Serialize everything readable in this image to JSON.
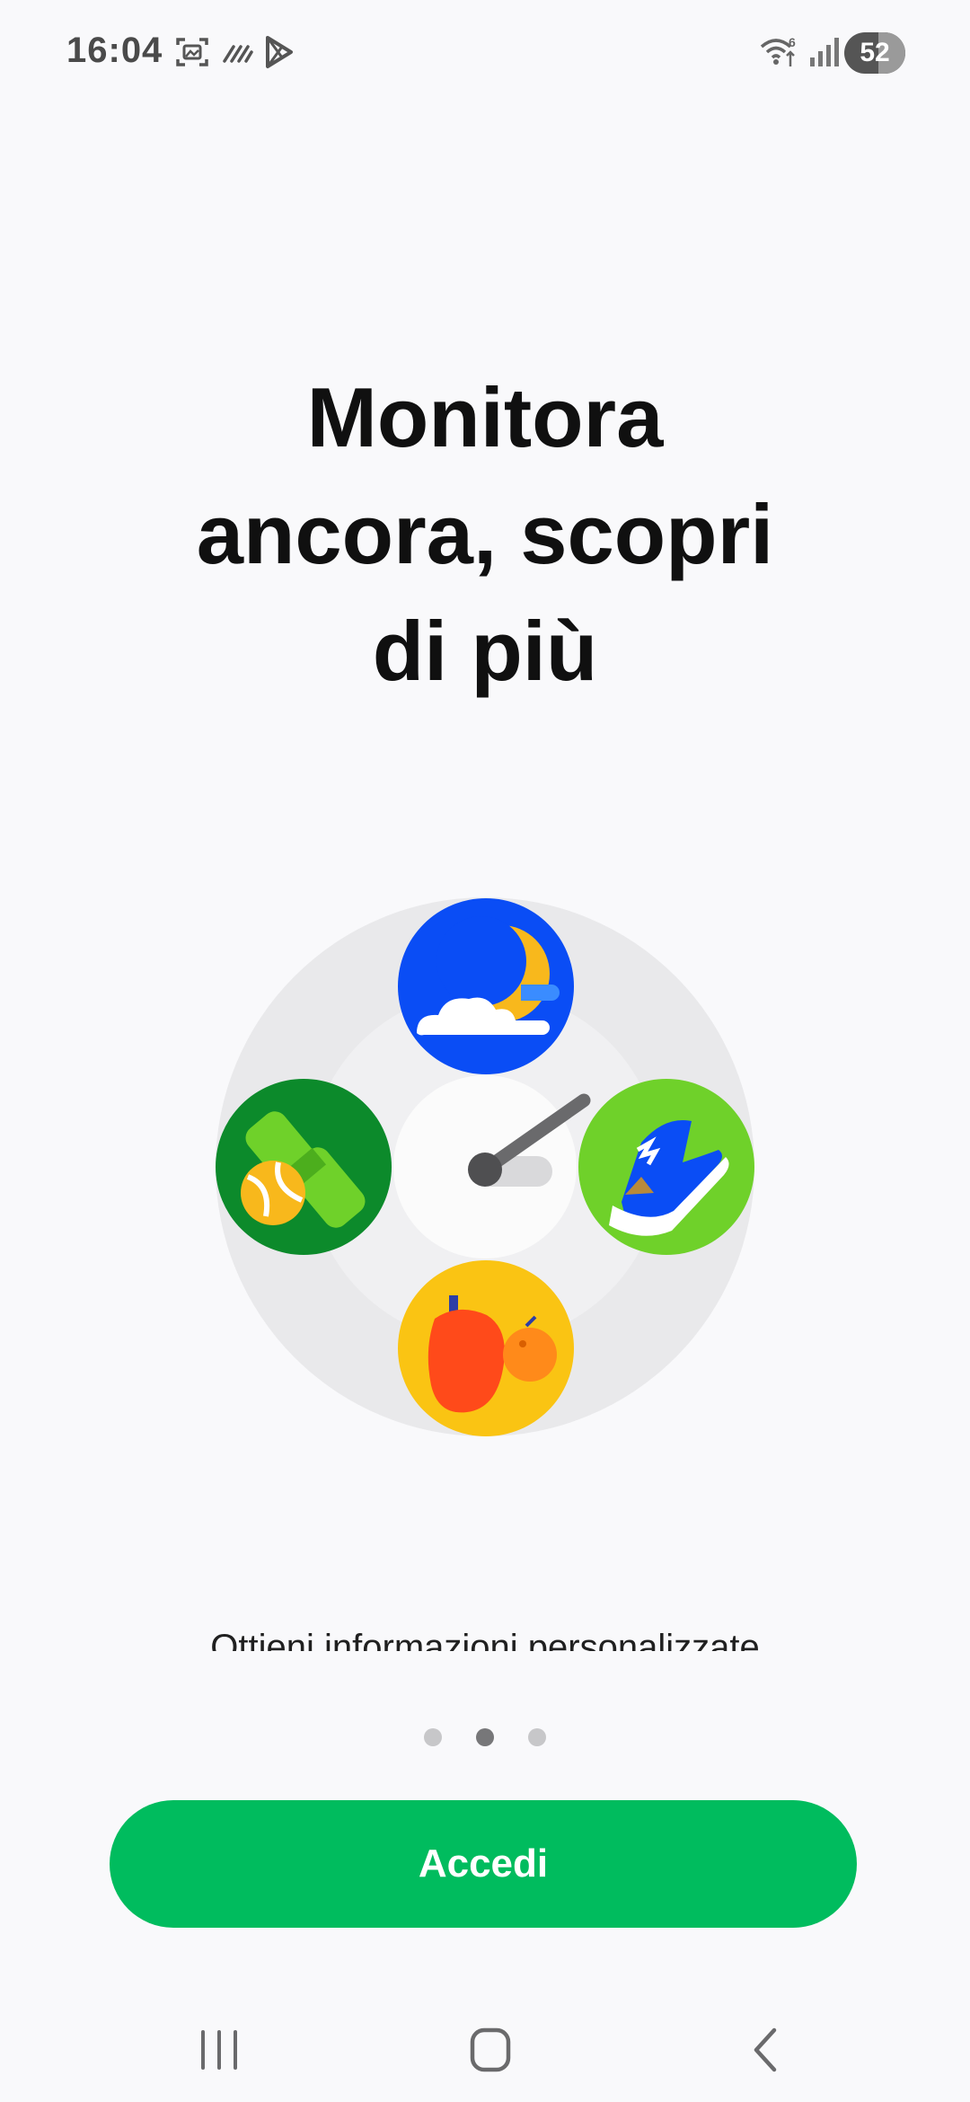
{
  "status_bar": {
    "time": "16:04",
    "left_icons": [
      "screenshot-icon",
      "nfc-icon",
      "play-store-icon"
    ],
    "right_icons": [
      "wifi-icon",
      "signal-icon"
    ],
    "battery": "52"
  },
  "onboarding": {
    "headline": "Monitora\nancora, scopri\ndi più",
    "subtitle": "Ottieni informazioni personalizzate",
    "illustration_icons": [
      "sleep-moon-icon",
      "exercise-dumbbell-icon",
      "running-shoe-icon",
      "food-pepper-icon",
      "gauge-icon"
    ],
    "pages": {
      "total": 3,
      "current": 2
    }
  },
  "actions": {
    "login_label": "Accedi"
  },
  "navigation": {
    "icons": [
      "recent-apps-icon",
      "home-icon",
      "back-icon"
    ]
  },
  "colors": {
    "primary": "#00bc5e",
    "background": "#f9f9fb",
    "sleep": "#0a4df5",
    "exercise": "#0c8a2b",
    "activity": "#6fd12a",
    "food": "#fac413"
  }
}
